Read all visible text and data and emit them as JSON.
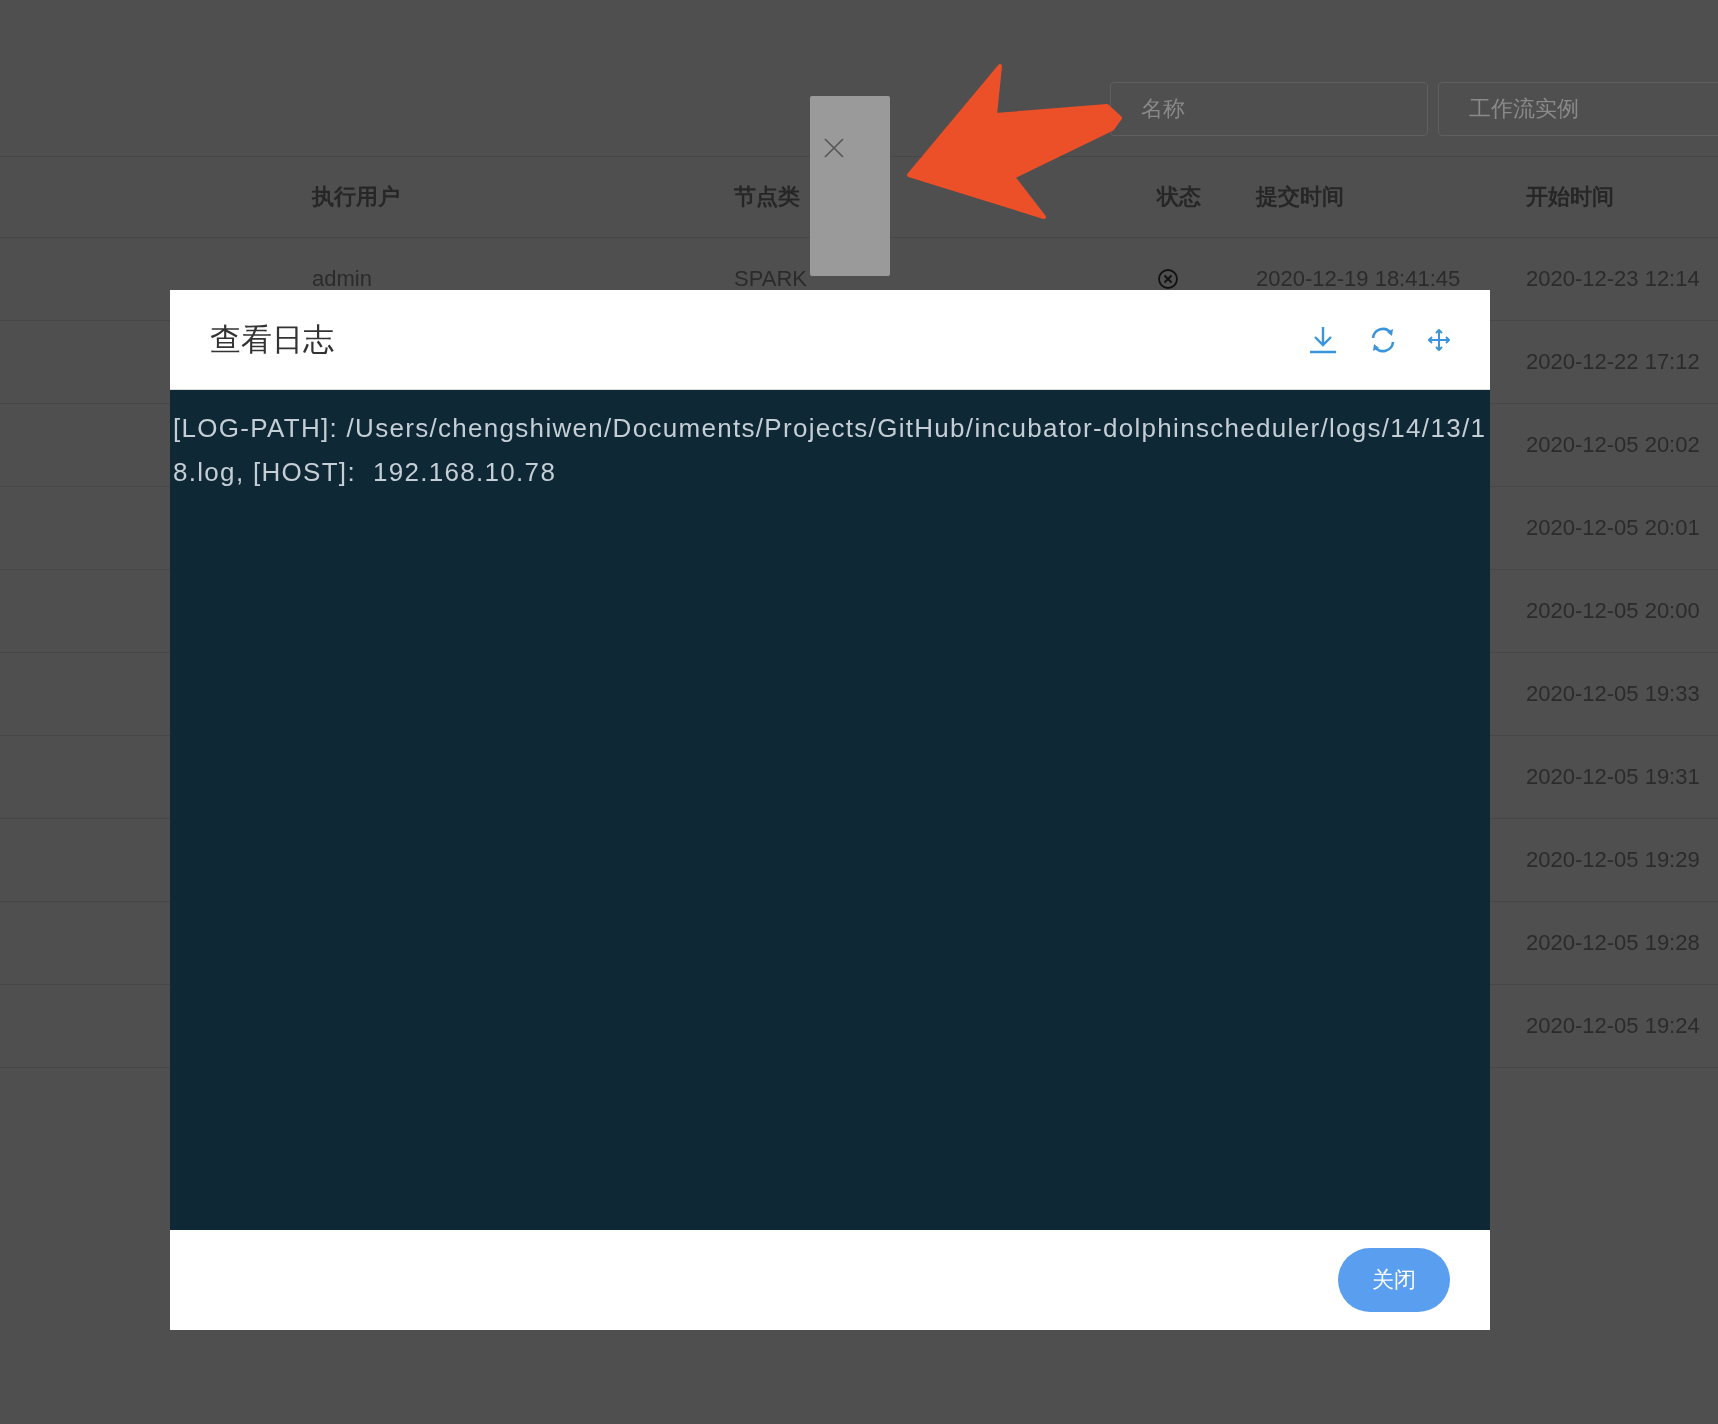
{
  "filters": [
    {
      "placeholder": "名称"
    },
    {
      "placeholder": "工作流实例"
    }
  ],
  "table": {
    "columns": [
      "执行用户",
      "节点类",
      "状态",
      "提交时间",
      "开始时间"
    ],
    "rows": [
      {
        "user": "admin",
        "node_type": "SPARK",
        "status_icon": {
          "kind": "failed"
        },
        "submit_time": "2020-12-19 18:41:45",
        "start_time": "2020-12-23 12:14"
      },
      {
        "start_time": "2020-12-22 17:12"
      },
      {
        "start_time": "2020-12-05 20:02"
      },
      {
        "start_time": "2020-12-05 20:01"
      },
      {
        "start_time": "2020-12-05 20:00"
      },
      {
        "start_time": "2020-12-05 19:33"
      },
      {
        "start_time": "2020-12-05 19:31"
      },
      {
        "start_time": "2020-12-05 19:29"
      },
      {
        "start_time": "2020-12-05 19:28"
      },
      {
        "start_time": "2020-12-05 19:24"
      }
    ]
  },
  "dialog": {
    "title": "查看日志",
    "tools": [
      {
        "kind": "download"
      },
      {
        "kind": "refresh"
      },
      {
        "kind": "move"
      }
    ],
    "log": "[LOG-PATH]: /Users/chengshiwen/Documents/Projects/GitHub/incubator-dolphinscheduler/logs/14/13/18.log, [HOST]:  192.168.10.78",
    "close_label": "关闭"
  }
}
